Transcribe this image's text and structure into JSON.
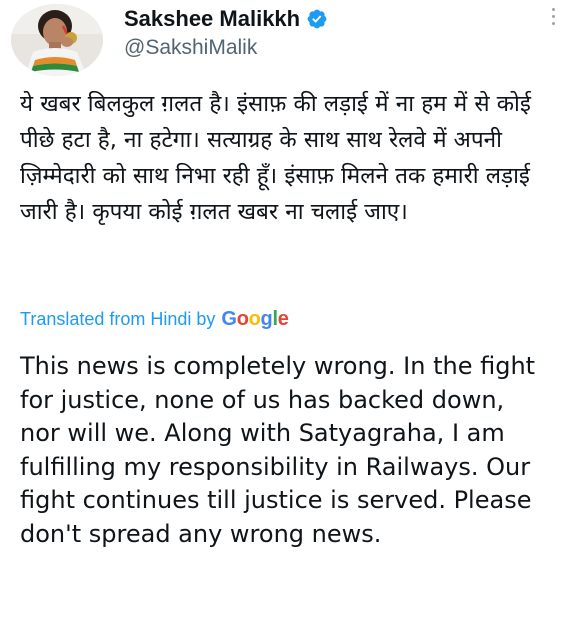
{
  "author": {
    "display_name": "Sakshee Malikkh",
    "handle": "@SakshiMalik",
    "verified": true,
    "verified_color": "#1d9bf0"
  },
  "icons": {
    "verified": "verified-badge-icon",
    "more": "more-options-icon"
  },
  "tweet": {
    "original_text": "ये खबर बिलकुल ग़लत है। इंसाफ़ की लड़ाई में ना हम में से कोई पीछे हटा है, ना हटेगा। सत्याग्रह के साथ साथ रेलवे में अपनी ज़िम्मेदारी को साथ निभा रही हूँ। इंसाफ़ मिलने तक हमारी लड़ाई जारी है। कृपया कोई ग़लत खबर ना चलाई जाए।",
    "translated_label": "Translated from Hindi by",
    "translation_provider": "Google",
    "translated_text": "This news is completely wrong. In the fight for justice, none of us has backed down, nor will we. Along with Satyagraha, I am fulfilling my responsibility in Railways. Our fight continues till justice is served. Please don't spread any wrong news."
  },
  "colors": {
    "text": "#0f1419",
    "secondary": "#536471",
    "link": "#1d9bf0"
  }
}
